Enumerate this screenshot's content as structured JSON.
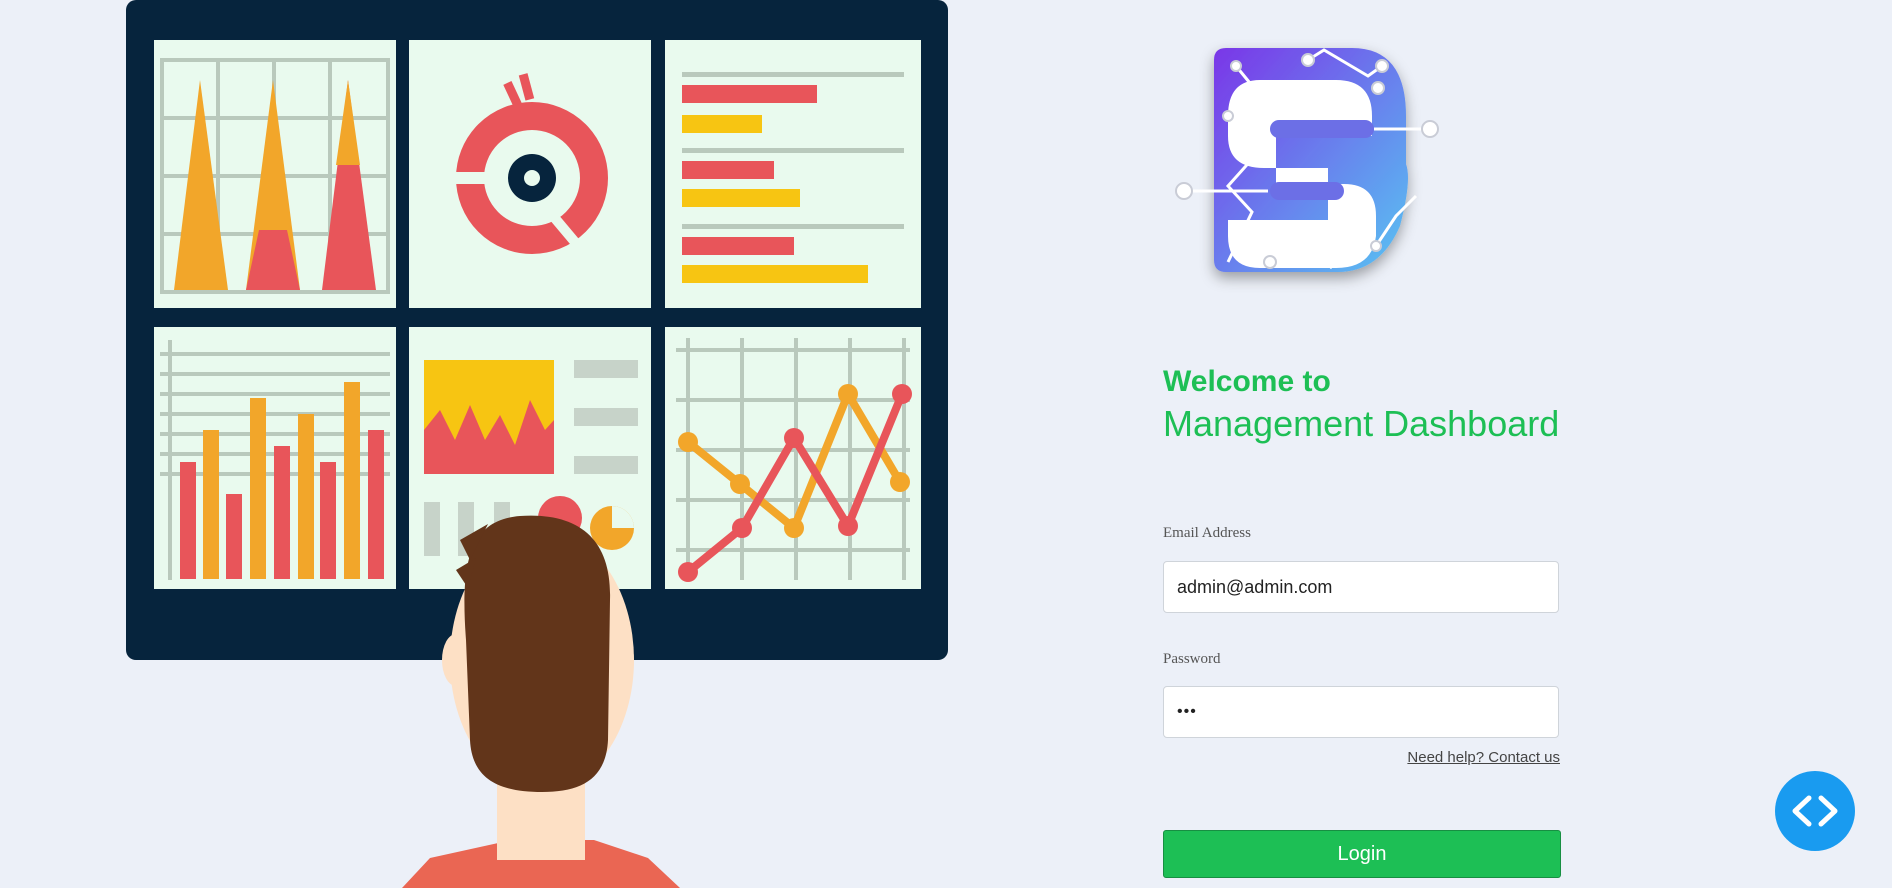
{
  "welcome": {
    "line1": "Welcome to",
    "line2": "Management Dashboard"
  },
  "form": {
    "email_label": "Email Address",
    "email_value": "admin@admin.com",
    "password_label": "Password",
    "password_value": "•••",
    "help_link": "Need help? Contact us",
    "login_label": "Login"
  },
  "colors": {
    "accent_green": "#1dbf55",
    "background": "#ecf0f8",
    "fab_blue": "#199bf0"
  },
  "icons": {
    "logo": "s-circuit-logo",
    "fab": "code-icon"
  }
}
